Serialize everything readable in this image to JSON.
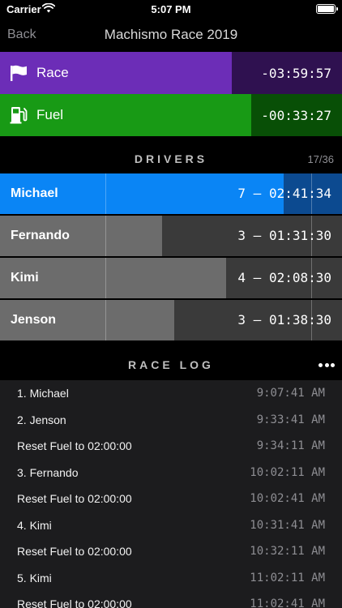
{
  "status": {
    "carrier": "Carrier",
    "time": "5:07 PM"
  },
  "nav": {
    "back": "Back",
    "title": "Machismo Race 2019"
  },
  "race": {
    "label": "Race",
    "value": "-03:59:57",
    "icon": "flag-icon"
  },
  "fuel": {
    "label": "Fuel",
    "value": "-00:33:27",
    "icon": "fuel-pump-icon"
  },
  "drivers_header": {
    "title": "DRIVERS",
    "count": "17/36"
  },
  "drivers": [
    {
      "name": "Michael",
      "stats": "7 — 02:41:34",
      "active": true,
      "progress": 0.83
    },
    {
      "name": "Fernando",
      "stats": "3 — 01:31:30",
      "active": false,
      "progress": 0.475
    },
    {
      "name": "Kimi",
      "stats": "4 — 02:08:30",
      "active": false,
      "progress": 0.66
    },
    {
      "name": "Jenson",
      "stats": "3 — 01:38:30",
      "active": false,
      "progress": 0.51
    }
  ],
  "racelog_header": {
    "title": "RACE LOG"
  },
  "log": [
    {
      "text": "1. Michael",
      "time": "9:07:41 AM"
    },
    {
      "text": "2. Jenson",
      "time": "9:33:41 AM"
    },
    {
      "text": "Reset Fuel to 02:00:00",
      "time": "9:34:11 AM"
    },
    {
      "text": "3. Fernando",
      "time": "10:02:11 AM"
    },
    {
      "text": "Reset Fuel to 02:00:00",
      "time": "10:02:41 AM"
    },
    {
      "text": "4. Kimi",
      "time": "10:31:41 AM"
    },
    {
      "text": "Reset Fuel to 02:00:00",
      "time": "10:32:11 AM"
    },
    {
      "text": "5. Kimi",
      "time": "11:02:11 AM"
    },
    {
      "text": "Reset Fuel to 02:00:00",
      "time": "11:02:41 AM"
    }
  ],
  "colors": {
    "race": "#6c2db7",
    "fuel": "#189a15",
    "active_driver": "#0a85f5",
    "inactive_driver": "#6c6c6c"
  }
}
